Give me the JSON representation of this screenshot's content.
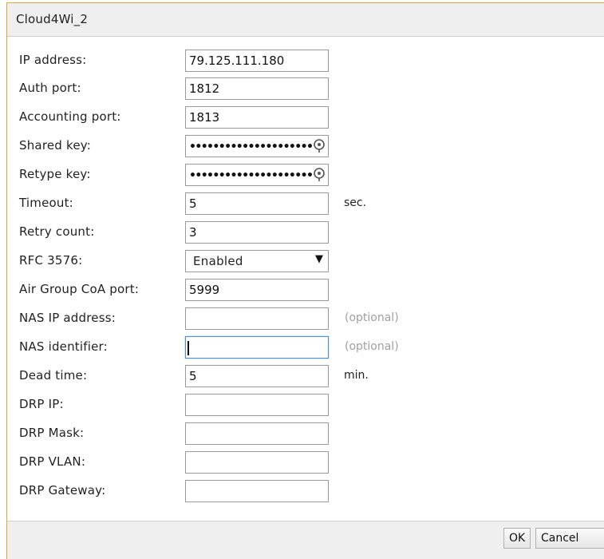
{
  "dialog": {
    "title": "Cloud4Wi_2"
  },
  "form": {
    "ip_address": {
      "label": "IP address:",
      "value": "79.125.111.180"
    },
    "auth_port": {
      "label": "Auth port:",
      "value": "1812"
    },
    "accounting_port": {
      "label": "Accounting port:",
      "value": "1813"
    },
    "shared_key": {
      "label": "Shared key:",
      "masked": "•••••••••••••••••••••"
    },
    "retype_key": {
      "label": "Retype key:",
      "masked": "•••••••••••••••••••••"
    },
    "timeout": {
      "label": "Timeout:",
      "value": "5",
      "unit": "sec."
    },
    "retry_count": {
      "label": "Retry count:",
      "value": "3"
    },
    "rfc3576": {
      "label": "RFC 3576:",
      "selected": "Enabled"
    },
    "air_group_coa_port": {
      "label": "Air Group CoA port:",
      "value": "5999"
    },
    "nas_ip_address": {
      "label": "NAS IP address:",
      "value": "",
      "hint": "(optional)"
    },
    "nas_identifier": {
      "label": "NAS identifier:",
      "value": "",
      "hint": "(optional)"
    },
    "dead_time": {
      "label": "Dead time:",
      "value": "5",
      "unit": "min."
    },
    "drp_ip": {
      "label": "DRP IP:",
      "value": ""
    },
    "drp_mask": {
      "label": "DRP Mask:",
      "value": ""
    },
    "drp_vlan": {
      "label": "DRP VLAN:",
      "value": ""
    },
    "drp_gateway": {
      "label": "DRP Gateway:",
      "value": ""
    }
  },
  "footer": {
    "ok_label": "OK",
    "cancel_label": "Cancel"
  },
  "colors": {
    "accent_border": "#f0a030",
    "focus_border": "#4a90d9",
    "hint_text": "#a0a0a0"
  }
}
